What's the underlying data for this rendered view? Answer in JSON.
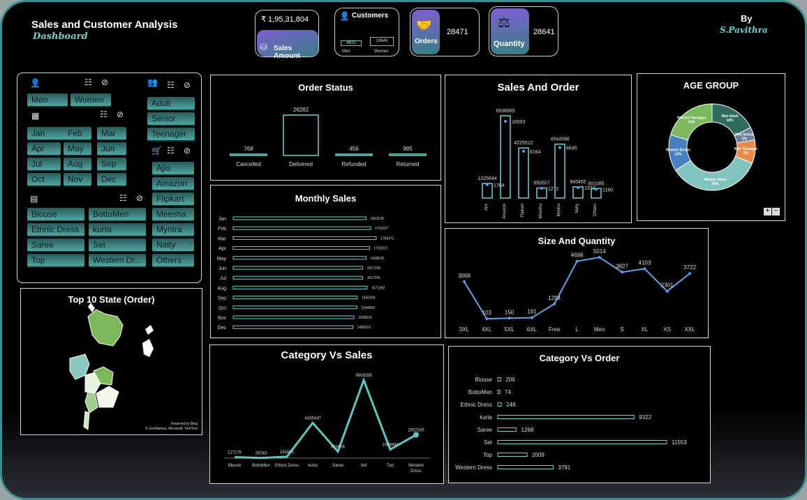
{
  "header": {
    "title": "Sales and Customer Analysis",
    "subtitle": "Dashboard",
    "by_label": "By",
    "author": "S.Pavithra"
  },
  "kpis": {
    "sales_amount": {
      "value": "₹ 1,95,31,804",
      "label": "Sales Amount"
    },
    "customers": {
      "label": "Customers",
      "men_value": "8821",
      "women_value": "19649",
      "men_label": "Men",
      "women_label": "Women"
    },
    "orders": {
      "label": "Orders",
      "value": "28471"
    },
    "quantity": {
      "label": "Quantity",
      "value": "28641"
    }
  },
  "slicers": {
    "gender": [
      "Men",
      "Women"
    ],
    "months": [
      "Jan",
      "Feb",
      "Mar",
      "Apr",
      "May",
      "Jun",
      "Jul",
      "Aug",
      "Sep",
      "Oct",
      "Nov",
      "Dec"
    ],
    "categories": [
      "Blouse",
      "BottoMen",
      "Ethnic Dress",
      "kurta",
      "Saree",
      "Set",
      "Top",
      "Western Dr..."
    ],
    "age": [
      "Adult",
      "Senior",
      "Teenager"
    ],
    "channels": [
      "Ajio",
      "Amazon",
      "Flipkart",
      "Meesha",
      "Myntra",
      "Nalty",
      "Others"
    ]
  },
  "map": {
    "title": "Top 10 State (Order)",
    "credit1": "Powered by Bing",
    "credit2": "© GeoNames, Microsoft, TomTom"
  },
  "age_group": {
    "title": "AGE GROUP",
    "zoom_in": "+",
    "zoom_out": "−"
  },
  "colors": {
    "accent": "#5fc7c0",
    "panel_border": "#d9d9d9",
    "bar_glow": "#6fd6cf"
  },
  "chart_data": [
    {
      "id": "order_status",
      "type": "bar",
      "title": "Order Status",
      "categories": [
        "Cancelled",
        "Delivered",
        "Refunded",
        "Returned"
      ],
      "values": [
        768,
        26262,
        456,
        985
      ]
    },
    {
      "id": "sales_and_order",
      "type": "bar",
      "title": "Sales And Order",
      "categories": [
        "Ajio",
        "Amazon",
        "Flipkart",
        "Meesha",
        "Myntra",
        "Nalty",
        "Others"
      ],
      "series": [
        {
          "values": [
            1225644,
            6938965,
            4225512,
            850557,
            4544586,
            945455,
            801085
          ]
        },
        {
          "values": [
            1764,
            10093,
            6164,
            1272,
            6645,
            1373,
            1160
          ]
        }
      ]
    },
    {
      "id": "age_group",
      "type": "pie",
      "title": "AGE GROUP",
      "categories": [
        "Men Adult",
        "Men Senior",
        "Men Teenager",
        "Women Adult",
        "Women Senior",
        "Women Teenager"
      ],
      "values": [
        18,
        5,
        9,
        36,
        14,
        21
      ],
      "labels": [
        "Men Adult 18%",
        "Men Senior 5%",
        "Men Teenager 9%",
        "Women Adult 36%",
        "Women Senior 14%",
        "Women Teenager 21%"
      ],
      "colors": [
        "#2f6b5f",
        "#6b7d9a",
        "#e98a4d",
        "#7fc4be",
        "#4a7fc0",
        "#7cb85c"
      ]
    },
    {
      "id": "monthly_sales",
      "type": "bar",
      "title": "Monthly Sales",
      "categories": [
        "Jan",
        "Feb",
        "Mar",
        "Apr",
        "May",
        "Jun",
        "Jul",
        "Aug",
        "Sep",
        "Oct",
        "Nov",
        "Dec"
      ],
      "values": [
        1661128,
        1716327,
        1786472,
        1702819,
        1658528,
        1617190,
        1617291,
        1671992,
        1550329,
        1544958,
        1508620,
        1495910
      ]
    },
    {
      "id": "size_quantity",
      "type": "line",
      "title": "Size And Quantity",
      "categories": [
        "3XL",
        "4XL",
        "5XL",
        "6XL",
        "Free",
        "L",
        "Men",
        "S",
        "XL",
        "XS",
        "XXL"
      ],
      "values": [
        3068,
        103,
        150,
        191,
        1294,
        4698,
        5014,
        3827,
        4103,
        2301,
        3722
      ]
    },
    {
      "id": "category_sales",
      "type": "line",
      "title": "Category Vs Sales",
      "categories": [
        "Blouse",
        "BottoMen",
        "Ethnic Dress",
        "kurta",
        "Saree",
        "Set",
        "Top",
        "Western Dress"
      ],
      "values": [
        127178,
        26343,
        181651,
        4435447,
        831656,
        9808289,
        1088894,
        2932345
      ]
    },
    {
      "id": "category_order",
      "type": "bar",
      "title": "Category Vs  Order",
      "categories": [
        "Blouse",
        "BottoMen",
        "Ethnic Dress",
        "kurta",
        "Saree",
        "Set",
        "Top",
        "Western Dress"
      ],
      "values": [
        206,
        74,
        248,
        9322,
        1268,
        11553,
        2009,
        3791
      ]
    }
  ]
}
